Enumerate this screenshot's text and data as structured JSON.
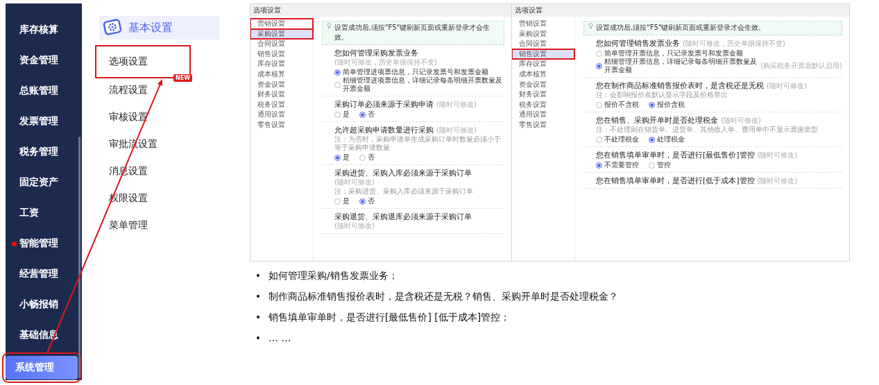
{
  "nav": {
    "items": [
      {
        "label": "库存核算",
        "selected": false,
        "dot": false,
        "highlighted": false
      },
      {
        "label": "资金管理",
        "selected": false,
        "dot": false,
        "highlighted": false
      },
      {
        "label": "总账管理",
        "selected": false,
        "dot": false,
        "highlighted": false
      },
      {
        "label": "发票管理",
        "selected": false,
        "dot": false,
        "highlighted": false
      },
      {
        "label": "税务管理",
        "selected": false,
        "dot": false,
        "highlighted": false
      },
      {
        "label": "固定资产",
        "selected": false,
        "dot": false,
        "highlighted": false
      },
      {
        "label": "工资",
        "selected": false,
        "dot": false,
        "highlighted": false
      },
      {
        "label": "智能管理",
        "selected": false,
        "dot": true,
        "highlighted": false
      },
      {
        "label": "经营管理",
        "selected": false,
        "dot": false,
        "highlighted": false
      },
      {
        "label": "小畅报销",
        "selected": false,
        "dot": false,
        "highlighted": false
      },
      {
        "label": "基础信息",
        "selected": false,
        "dot": false,
        "highlighted": false
      },
      {
        "label": "系统管理",
        "selected": true,
        "dot": false,
        "highlighted": true
      }
    ]
  },
  "submenu": {
    "header": "基本设置",
    "items": [
      {
        "label": "选项设置",
        "highlighted": true
      },
      {
        "label": "流程设置",
        "highlighted": false,
        "badge": "NEW"
      },
      {
        "label": "审核设置",
        "highlighted": false
      },
      {
        "label": "审批流设置",
        "highlighted": false
      },
      {
        "label": "消息设置",
        "highlighted": false
      },
      {
        "label": "权限设置",
        "highlighted": false
      },
      {
        "label": "菜单管理",
        "highlighted": false
      }
    ]
  },
  "screenshots": [
    {
      "title": "选项设置",
      "menu": [
        {
          "label": "营销设置",
          "selected": false,
          "highlighted": true
        },
        {
          "label": "采购设置",
          "selected": true,
          "highlighted": true
        },
        {
          "label": "合同设置",
          "selected": false,
          "highlighted": false
        },
        {
          "label": "销售设置",
          "selected": false,
          "highlighted": false
        },
        {
          "label": "库存设置",
          "selected": false,
          "highlighted": false
        },
        {
          "label": "成本核算",
          "selected": false,
          "highlighted": false
        },
        {
          "label": "资金设置",
          "selected": false,
          "highlighted": false
        },
        {
          "label": "财务设置",
          "selected": false,
          "highlighted": false
        },
        {
          "label": "税务设置",
          "selected": false,
          "highlighted": false
        },
        {
          "label": "通用设置",
          "selected": false,
          "highlighted": false
        },
        {
          "label": "零售设置",
          "selected": false,
          "highlighted": false
        }
      ],
      "notice": "设置成功后,须按\"F5\"键刷新页面或重新登录才会生效。",
      "sections": [
        {
          "title": "您如何管理采购发票业务",
          "hint": "(随时可修改，历史单据保持不变)",
          "options": [
            {
              "label": "简单管理进项票信息，只记录发票号和发票金额",
              "selected": true
            },
            {
              "label": "精细管理进项票信息，详细记录每条明细开票数量及开票金额",
              "selected": false
            }
          ]
        },
        {
          "title": "采购订单必须来源于采购申请",
          "hint": "(随时可修改)",
          "options": [
            {
              "label": "是",
              "selected": false
            },
            {
              "label": "否",
              "selected": true
            }
          ]
        },
        {
          "title": "允许超采购申请数量进行采购",
          "hint": "(随时可修改)",
          "note": "注：为否时，采购申请单生成采购订单时数量必须小于等于采购申请数量",
          "options": [
            {
              "label": "是",
              "selected": true
            },
            {
              "label": "否",
              "selected": false
            }
          ]
        },
        {
          "title": "采购进货、采购入库必须来源于采购订单",
          "hint": "(随时可修改)",
          "note": "注：采购进货、采购入库必须来源于采购订单",
          "options": [
            {
              "label": "是",
              "selected": false
            },
            {
              "label": "否",
              "selected": true
            }
          ]
        },
        {
          "title": "采购退货、采购退库必须来源于采购订单",
          "hint": "(随时可修改)"
        }
      ]
    },
    {
      "title": "选项设置",
      "menu": [
        {
          "label": "营销设置",
          "selected": false,
          "highlighted": false
        },
        {
          "label": "采购设置",
          "selected": false,
          "highlighted": false
        },
        {
          "label": "合同设置",
          "selected": false,
          "highlighted": false
        },
        {
          "label": "销售设置",
          "selected": true,
          "highlighted": true
        },
        {
          "label": "库存设置",
          "selected": false,
          "highlighted": false
        },
        {
          "label": "成本核算",
          "selected": false,
          "highlighted": false
        },
        {
          "label": "资金设置",
          "selected": false,
          "highlighted": false
        },
        {
          "label": "财务设置",
          "selected": false,
          "highlighted": false
        },
        {
          "label": "税务设置",
          "selected": false,
          "highlighted": false
        },
        {
          "label": "通用设置",
          "selected": false,
          "highlighted": false
        },
        {
          "label": "零售设置",
          "selected": false,
          "highlighted": false
        }
      ],
      "notice": "设置成功后,须按\"F5\"键刷新页面或重新登录才会生效。",
      "sections": [
        {
          "title": "您如何管理销售发票业务",
          "hint": "(随时可修改，历史单据保持不变)",
          "options": [
            {
              "label": "简单管理开票信息，只记录发票号和发票金额",
              "selected": false
            },
            {
              "label": "精细管理开票信息，详细记录每条明细开票数量及开票金额",
              "selected": true,
              "hint": "(购买税务开票后默认启用)"
            }
          ]
        },
        {
          "title": "您在制作商品标准销售报价表时，是含税还是无税",
          "hint": "(随时可修改)",
          "note": "注：会影响报价表默认显示字段及价格带出",
          "options": [
            {
              "label": "报价不含税",
              "selected": false
            },
            {
              "label": "报价含税",
              "selected": true
            }
          ]
        },
        {
          "title": "您在销售、采购开单时是否处理税金",
          "hint": "(随时可修改)",
          "note": "注：不处理则在销货单、进货单、其他收入单、费用单中不显示票据类型",
          "options": [
            {
              "label": "不处理税金",
              "selected": false
            },
            {
              "label": "处理税金",
              "selected": true
            }
          ]
        },
        {
          "title": "您在销售填单审单时，是否进行[最低售价]管控",
          "hint": "(随时可修改)",
          "options": [
            {
              "label": "不需要管控",
              "selected": true
            },
            {
              "label": "管控",
              "selected": false
            }
          ]
        },
        {
          "title": "您在销售填单审单时，是否进行[低于成本]管控",
          "hint": "(随时可修改)"
        }
      ]
    }
  ],
  "bullets": [
    "如何管理采购/销售发票业务；",
    "制作商品标准销售报价表时，是含税还是无税？销售、采购开单时是否处理税金？",
    "销售填单审单时，是否进行[最低售价] [低于成本]管控；",
    "… …"
  ]
}
